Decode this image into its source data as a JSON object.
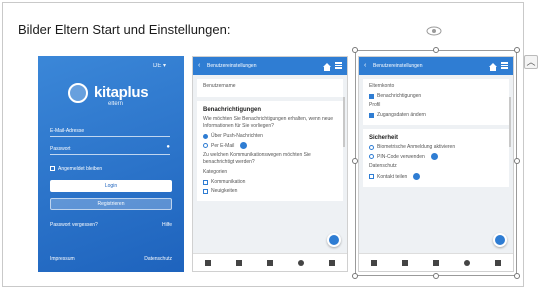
{
  "heading": "Bilder Eltern Start und Einstellungen:",
  "login": {
    "top_right": "DE ▾",
    "brand": "kitaplus",
    "brand_sub": "eltern",
    "email_label": "E-Mail-Adresse",
    "password_label": "Passwort",
    "remember_label": "Angemeldet bleiben",
    "login_button": "Login",
    "register_button": "Registrieren",
    "forgot_left": "Passwort vergessen?",
    "forgot_right": "Hilfe",
    "footer_left": "Impressum",
    "footer_right": "Datenschutz"
  },
  "panel2": {
    "bar_title": "Benutzereinstellungen",
    "top_label": "Benutzername",
    "section_title": "Benachrichtigungen",
    "text1": "Wie möchten Sie Benachrichtigungen erhalten, wenn neue Informationen für Sie vorliegen?",
    "opt1": "Über Push-Nachrichten",
    "opt2": "Per E-Mail",
    "text2": "Zu welchen Kommunikationswegen möchten Sie benachrichtigt werden?",
    "sub_label": "Kategorien",
    "chk1": "Kommunikation",
    "chk2": "Neuigkeiten"
  },
  "panel3": {
    "bar_title": "Benutzereinstellungen",
    "label1": "Elternkonto",
    "chk1": "Benachrichtigungen",
    "label2": "Profil",
    "chk2": "Zugangsdaten ändern",
    "section_title": "Sicherheit",
    "opt1": "Biometrische Anmeldung aktivieren",
    "opt2": "PIN-Code verwenden",
    "label3": "Datenschutz",
    "chk3": "Kontakt teilen"
  }
}
